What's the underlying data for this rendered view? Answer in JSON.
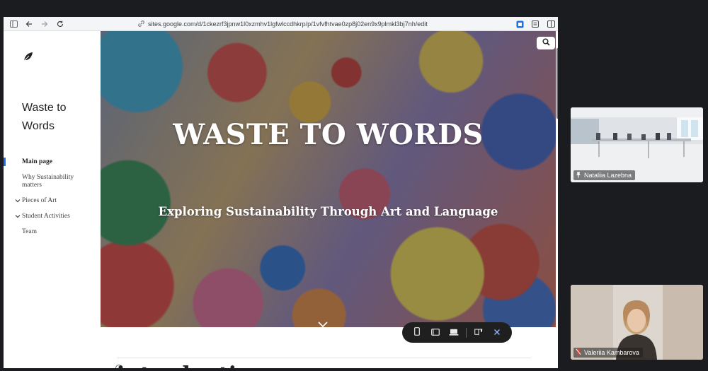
{
  "browser": {
    "url": "sites.google.com/d/1ckezrf3jpnw1l0xzmhv1lgfwlccdhkrp/p/1vfvfhtvae0zp8j02en9x9plmkl3bj7nh/edit"
  },
  "site": {
    "title": "Waste to Words",
    "nav": [
      {
        "label": "Main page",
        "active": true,
        "expandable": false
      },
      {
        "label": "Why Sustainability matters",
        "active": false,
        "expandable": false
      },
      {
        "label": "Pieces of Art",
        "active": false,
        "expandable": true
      },
      {
        "label": "Student Activities",
        "active": false,
        "expandable": true
      },
      {
        "label": "Team",
        "active": false,
        "expandable": false
      }
    ],
    "hero": {
      "title": "WASTE TO WORDS",
      "subtitle": "Exploring Sustainability Through Art and Language"
    },
    "section_heading": "introduction"
  },
  "participants": [
    {
      "name": "Nataliia Lazebna",
      "icon": "pin-icon"
    },
    {
      "name": "Valeriia Kambarova",
      "icon": "mic-muted-icon"
    }
  ],
  "colors": {
    "accent": "#1a73e8",
    "preview_bar": "#1f1f1f",
    "background": "#1a1c1f"
  }
}
